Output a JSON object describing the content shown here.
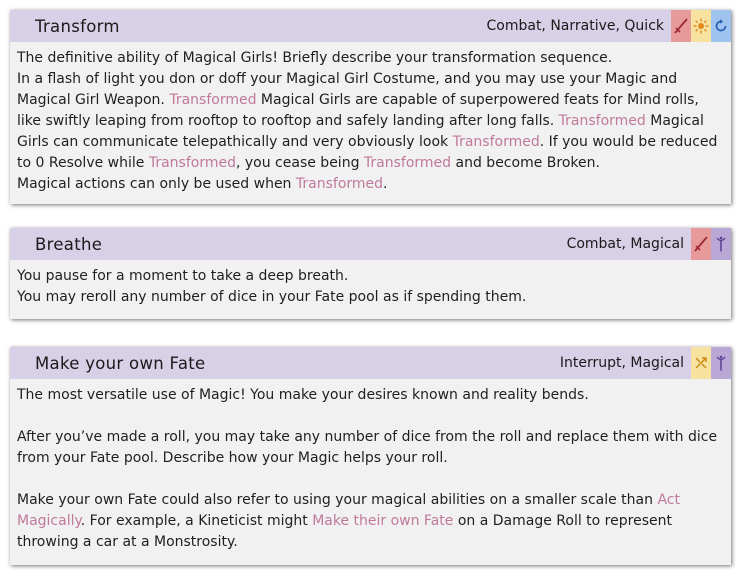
{
  "cards": [
    {
      "title": "Transform",
      "tags": "Combat, Narrative, Quick",
      "icons": [
        "sword-icon",
        "sun-icon",
        "refresh-icon"
      ],
      "lines": {
        "l1": "The definitive ability of Magical Girls! Briefly describe your transformation sequence.",
        "l2a": "In a flash of light you don or doff your Magical Girl Costume, and you may use your Magic and Magical Girl Weapon.",
        "kw1": "Transformed",
        "l2b": "Magical Girls are capable of superpowered feats for Mind rolls, like swiftly leaping from rooftop to rooftop and safely landing after long falls.",
        "kw2": "Transformed",
        "l2c": "Magical Girls can communicate telepathically and very obviously look",
        "kw3": "Transformed",
        "l2d": ". If you would be reduced to 0 Resolve while",
        "kw4": "Transformed",
        "l2e": ", you cease being",
        "kw5": "Transformed",
        "l2f": "and become Broken.",
        "l3a": "Magical actions can only be used when",
        "kw6": "Transformed",
        "l3b": "."
      }
    },
    {
      "title": "Breathe",
      "tags": "Combat, Magical",
      "icons": [
        "sword-icon",
        "wand-icon"
      ],
      "lines": {
        "l1": "You pause for a moment to take a deep breath.",
        "l2": "You may reroll any number of dice in your Fate pool as if spending them."
      }
    },
    {
      "title": "Make your own Fate",
      "tags": "Interrupt, Magical",
      "icons": [
        "crossed-arrows-icon",
        "wand-icon"
      ],
      "lines": {
        "p1": "The most versatile use of Magic! You make your desires known and reality bends.",
        "p2": "After you’ve made a roll, you may take any number of dice from the roll and replace them with dice from your Fate pool. Describe how your Magic helps your roll.",
        "p3a": "Make your own Fate could also refer to using your magical abilities on a smaller scale than",
        "kw1": "Act Magically",
        "p3b": ". For example, a Kineticist might",
        "kw2": "Make their own Fate",
        "p3c": "on a Damage Roll to represent throwing a car at a Monstrosity."
      }
    }
  ],
  "colors": {
    "header_bg": "#d8d0e6",
    "card_bg": "#f1f1f1",
    "keyword": "#c0799b",
    "icon_red": "#e69a9a",
    "icon_yellow": "#f7e2a0",
    "icon_blue": "#9ec3ef",
    "icon_purple": "#b9a8d6"
  }
}
